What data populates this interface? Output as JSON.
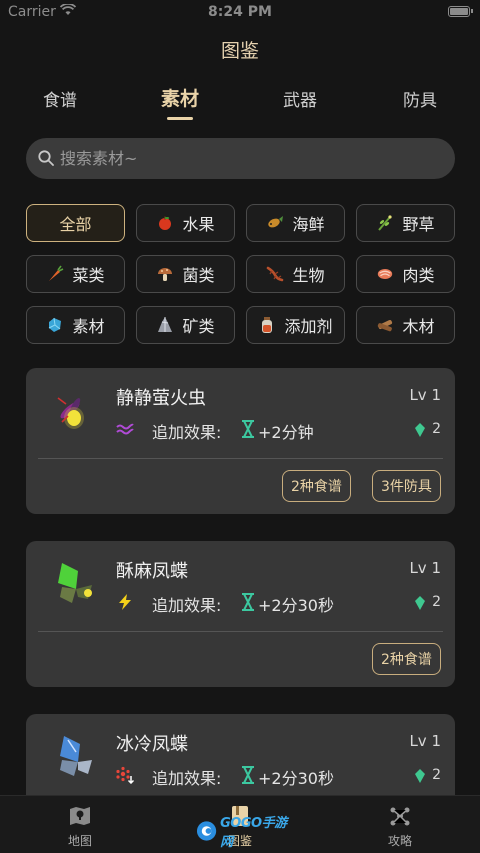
{
  "status_bar": {
    "carrier": "Carrier",
    "time": "8:24 PM"
  },
  "page_title": "图鉴",
  "tabs": [
    {
      "label": "食谱"
    },
    {
      "label": "素材"
    },
    {
      "label": "武器"
    },
    {
      "label": "防具"
    }
  ],
  "active_tab": "素材",
  "search": {
    "placeholder": "搜索素材~"
  },
  "filters": [
    {
      "label": "全部",
      "icon": "none"
    },
    {
      "label": "水果",
      "icon": "apple-icon"
    },
    {
      "label": "海鲜",
      "icon": "fish-icon"
    },
    {
      "label": "野草",
      "icon": "herb-icon"
    },
    {
      "label": "菜类",
      "icon": "carrot-icon"
    },
    {
      "label": "菌类",
      "icon": "mushroom-icon"
    },
    {
      "label": "生物",
      "icon": "lizard-icon"
    },
    {
      "label": "肉类",
      "icon": "meat-icon"
    },
    {
      "label": "素材",
      "icon": "crystal-icon"
    },
    {
      "label": "矿类",
      "icon": "ore-icon"
    },
    {
      "label": "添加剂",
      "icon": "bottle-icon"
    },
    {
      "label": "木材",
      "icon": "wood-icon"
    }
  ],
  "active_filter": "全部",
  "materials": [
    {
      "name": "静静萤火虫",
      "level": "Lv 1",
      "effect_label": "追加效果:",
      "effect_icon": "stealth-icon",
      "effect_value": "+2分钟",
      "gem_count": "2",
      "tags": [
        "2种食谱",
        "3件防具"
      ]
    },
    {
      "name": "酥麻凤蝶",
      "level": "Lv 1",
      "effect_label": "追加效果:",
      "effect_icon": "lightning-icon",
      "effect_value": "+2分30秒",
      "gem_count": "2",
      "tags": [
        "2种食谱"
      ]
    },
    {
      "name": "冰冷凤蝶",
      "level": "Lv 1",
      "effect_label": "追加效果:",
      "effect_icon": "cold-resist-icon",
      "effect_value": "+2分30秒",
      "gem_count": "2",
      "tags": []
    }
  ],
  "bottom_nav": [
    {
      "label": "地图",
      "icon": "map-icon"
    },
    {
      "label": "图鉴",
      "icon": "book-icon"
    },
    {
      "label": "攻略",
      "icon": "guide-icon"
    }
  ],
  "watermark": {
    "text": "GOGO手游网"
  },
  "colors": {
    "accent": "#e9d3a8",
    "background": "#151515",
    "card": "#373737",
    "effect_green": "#3cc8a0",
    "effect_purple": "#b04bd6",
    "effect_yellow": "#f5d21a"
  }
}
